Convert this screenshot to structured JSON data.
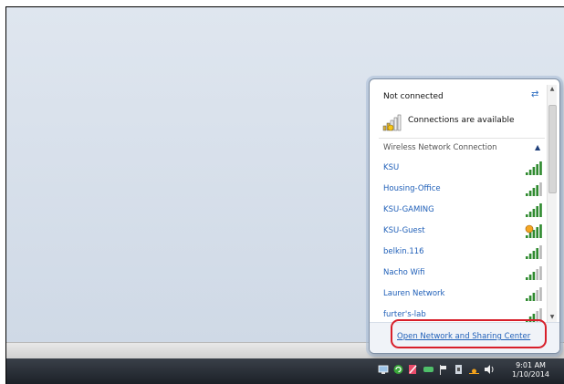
{
  "network_popup": {
    "status": "Not connected",
    "availability": "Connections are available",
    "section_title": "Wireless Network Connection",
    "networks": [
      {
        "name": "KSU",
        "signal": 5,
        "secured": false
      },
      {
        "name": "Housing-Office",
        "signal": 4,
        "secured": false
      },
      {
        "name": "KSU-GAMING",
        "signal": 5,
        "secured": false
      },
      {
        "name": "KSU-Guest",
        "signal": 5,
        "secured": false,
        "warning": true
      },
      {
        "name": "belkin.116",
        "signal": 4,
        "secured": false
      },
      {
        "name": "Nacho Wifi",
        "signal": 3,
        "secured": false
      },
      {
        "name": "Lauren Network",
        "signal": 3,
        "secured": false
      },
      {
        "name": "furter's-lab",
        "signal": 3,
        "secured": false
      }
    ],
    "footer_link": "Open Network and Sharing Center"
  },
  "taskbar": {
    "time": "9:01 AM",
    "date": "1/10/2014",
    "tray_icons": [
      "network-icon",
      "refresh-green-icon",
      "tool-icon",
      "display-icon",
      "flag-icon",
      "usb-icon",
      "power-icon",
      "volume-icon"
    ]
  },
  "colors": {
    "link": "#1f5fb8",
    "highlight": "#d81f2a",
    "signal_green": "#2f8a2f",
    "signal_gray": "#b8b8b8",
    "taskbar": "#1c2128"
  }
}
